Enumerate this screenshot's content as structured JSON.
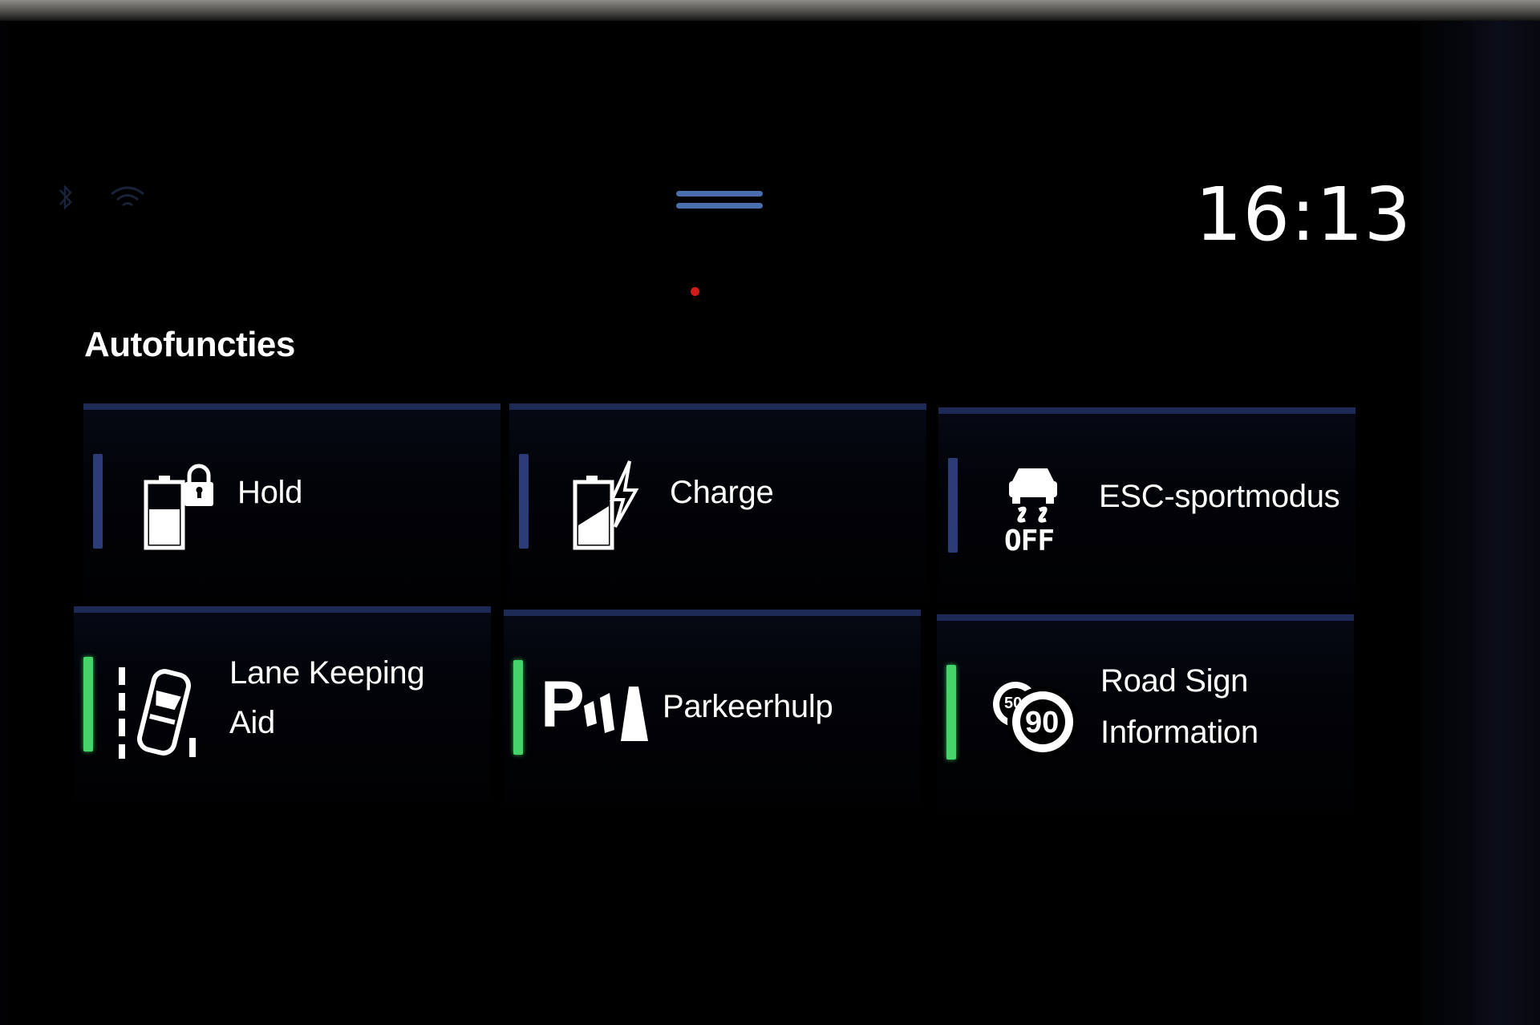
{
  "status_bar": {
    "icons": [
      "bluetooth-icon",
      "wifi-icon"
    ],
    "time": "16:13",
    "handle_icon": "drag-handle-icon"
  },
  "section": {
    "title": "Autofuncties"
  },
  "tiles": [
    {
      "id": "hold",
      "label": "Hold",
      "icon": "battery-lock-icon",
      "active": false
    },
    {
      "id": "charge",
      "label": "Charge",
      "icon": "battery-charge-icon",
      "active": false
    },
    {
      "id": "esc",
      "label": "ESC-sportmodus",
      "icon": "esc-off-icon",
      "icon_text": "OFF",
      "active": false
    },
    {
      "id": "lane",
      "label_line1": "Lane Keeping",
      "label_line2": "Aid",
      "icon": "lane-keeping-icon",
      "active": true
    },
    {
      "id": "park",
      "label": "Parkeerhulp",
      "icon": "park-assist-icon",
      "icon_text": "P",
      "active": true
    },
    {
      "id": "road",
      "label_line1": "Road Sign",
      "label_line2": "Information",
      "icon": "road-sign-icon",
      "icon_text_back": "50",
      "icon_text_front": "90",
      "active": true
    }
  ],
  "colors": {
    "indicator_off": "#2b3c77",
    "indicator_on": "#45d46a",
    "tile_border": "#1d2a55",
    "handle": "#4a6fae",
    "record_dot": "#d11a1a"
  }
}
